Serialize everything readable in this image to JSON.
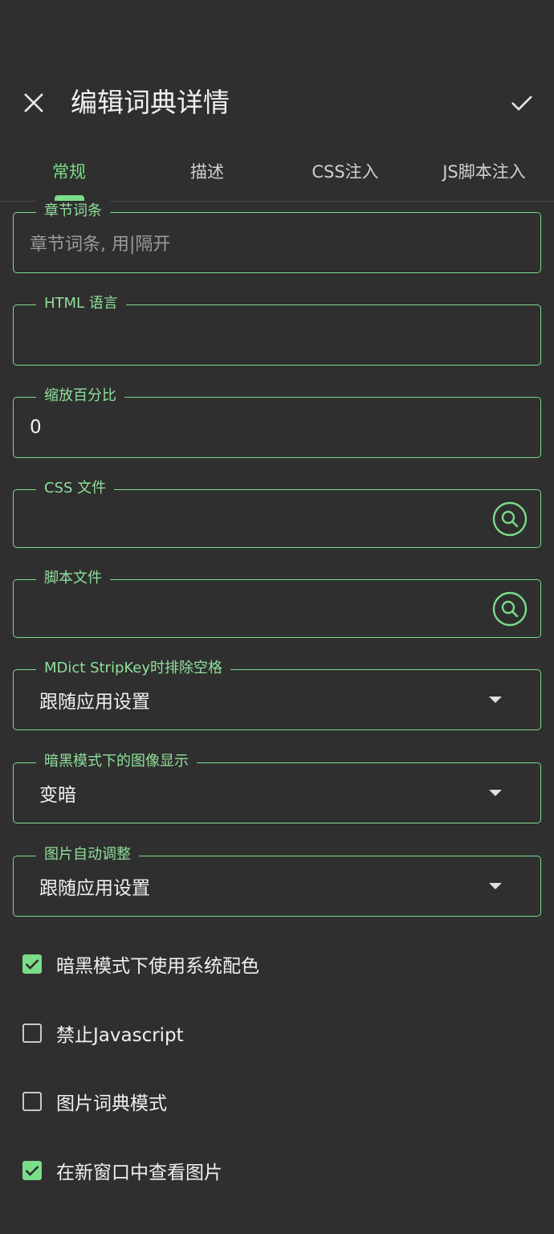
{
  "header": {
    "title": "编辑词典详情",
    "close_icon": "close-icon",
    "confirm_icon": "check-icon"
  },
  "tabs": [
    {
      "label": "常规",
      "active": true
    },
    {
      "label": "描述",
      "active": false
    },
    {
      "label": "CSS注入",
      "active": false
    },
    {
      "label": "JS脚本注入",
      "active": false
    }
  ],
  "fields": {
    "chapter_entries": {
      "label": "章节词条",
      "value": "",
      "placeholder": "章节词条, 用|隔开"
    },
    "html_language": {
      "label": "HTML 语言",
      "value": ""
    },
    "zoom_percent": {
      "label": "缩放百分比",
      "value": "0"
    },
    "css_file": {
      "label": "CSS 文件",
      "value": "",
      "icon": "search-icon"
    },
    "script_file": {
      "label": "脚本文件",
      "value": "",
      "icon": "search-icon"
    }
  },
  "selects": {
    "mdict_stripkey": {
      "label": "MDict StripKey时排除空格",
      "value": "跟随应用设置"
    },
    "dark_image": {
      "label": "暗黑模式下的图像显示",
      "value": "变暗"
    },
    "image_autofit": {
      "label": "图片自动调整",
      "value": "跟随应用设置"
    }
  },
  "checkboxes": [
    {
      "label": "暗黑模式下使用系统配色",
      "checked": true
    },
    {
      "label": "禁止Javascript",
      "checked": false
    },
    {
      "label": "图片词典模式",
      "checked": false
    },
    {
      "label": "在新窗口中查看图片",
      "checked": true
    }
  ],
  "colors": {
    "accent": "#7bdc8a",
    "background": "#2f2f2f"
  }
}
